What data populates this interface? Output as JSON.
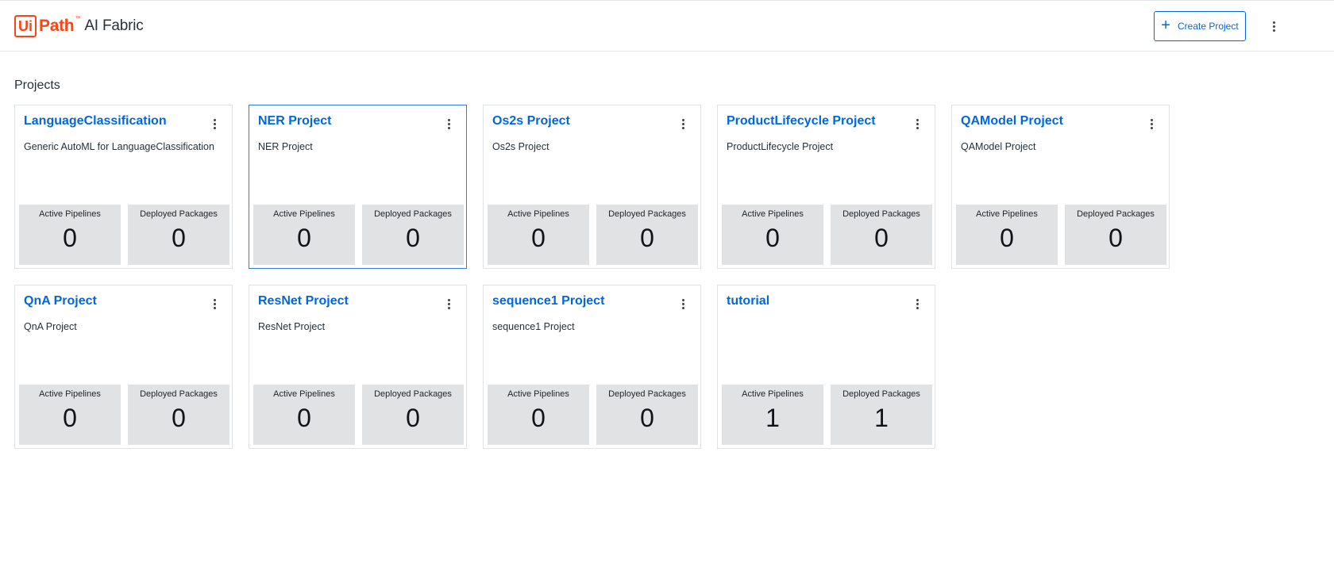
{
  "header": {
    "logo_ui": "Ui",
    "logo_path": "Path",
    "logo_tm": "™",
    "product_name": "AI Fabric",
    "create_button_label": "Create Project",
    "create_button_icon": "plus-icon",
    "menu_icon": "more-vertical-icon"
  },
  "main": {
    "section_title": "Projects",
    "stat_labels": {
      "pipelines": "Active Pipelines",
      "packages": "Deployed Packages"
    },
    "projects": [
      {
        "title": "LanguageClassification",
        "description": "Generic AutoML for LanguageClassification",
        "active_pipelines": "0",
        "deployed_packages": "0"
      },
      {
        "title": "NER Project",
        "description": "NER Project",
        "active_pipelines": "0",
        "deployed_packages": "0"
      },
      {
        "title": "Os2s Project",
        "description": "Os2s Project",
        "active_pipelines": "0",
        "deployed_packages": "0"
      },
      {
        "title": "ProductLifecycle Project",
        "description": "ProductLifecycle Project",
        "active_pipelines": "0",
        "deployed_packages": "0"
      },
      {
        "title": "QAModel Project",
        "description": "QAModel Project",
        "active_pipelines": "0",
        "deployed_packages": "0"
      },
      {
        "title": "QnA Project",
        "description": "QnA Project",
        "active_pipelines": "0",
        "deployed_packages": "0"
      },
      {
        "title": "ResNet Project",
        "description": "ResNet Project",
        "active_pipelines": "0",
        "deployed_packages": "0"
      },
      {
        "title": "sequence1 Project",
        "description": "sequence1 Project",
        "active_pipelines": "0",
        "deployed_packages": "0"
      },
      {
        "title": "tutorial",
        "description": "",
        "active_pipelines": "1",
        "deployed_packages": "1"
      }
    ]
  },
  "colors": {
    "brand_orange": "#fa4616",
    "link_blue": "#0067df",
    "stat_background": "#e1e2e4"
  }
}
